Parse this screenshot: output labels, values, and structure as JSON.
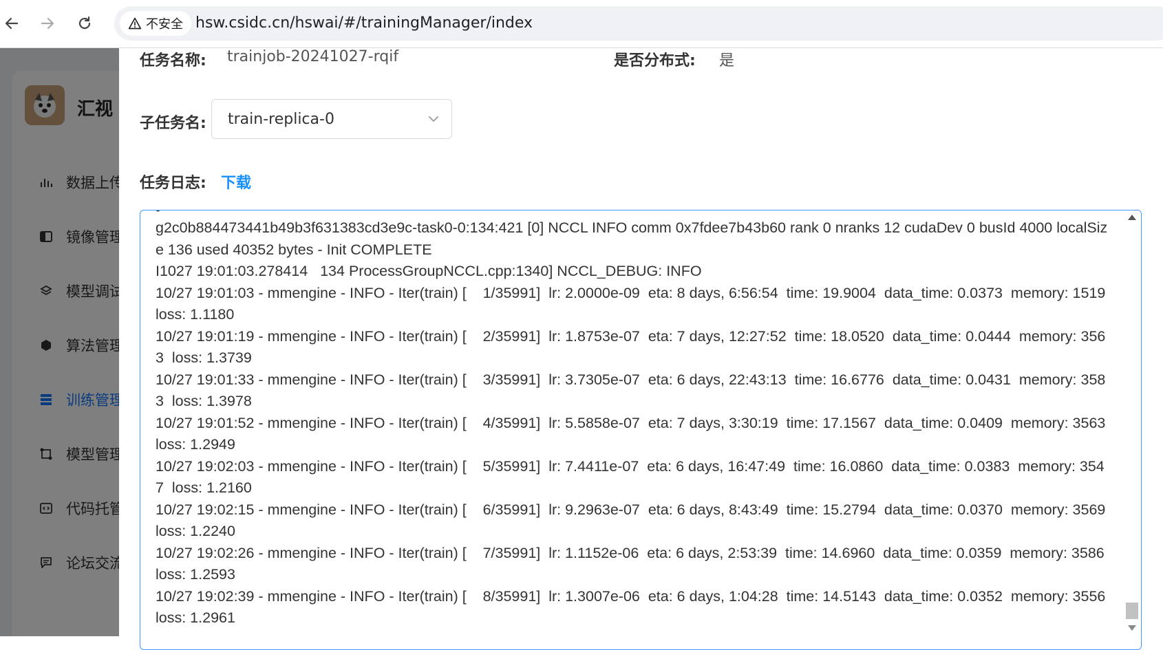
{
  "browser": {
    "back_icon": "arrow-left-icon",
    "forward_icon": "arrow-right-icon",
    "reload_icon": "reload-icon",
    "security_label": "不安全",
    "url": "hsw.csidc.cn/hswai/#/trainingManager/index"
  },
  "sidebar": {
    "brand": "汇视",
    "items": [
      {
        "label": "数据上传",
        "icon": "bar-chart-icon"
      },
      {
        "label": "镜像管理",
        "icon": "book-icon"
      },
      {
        "label": "模型调试",
        "icon": "layers-icon"
      },
      {
        "label": "算法管理",
        "icon": "cube-icon"
      },
      {
        "label": "训练管理",
        "icon": "list-icon",
        "active": true
      },
      {
        "label": "模型管理",
        "icon": "network-icon"
      },
      {
        "label": "代码托管",
        "icon": "code-icon"
      },
      {
        "label": "论坛交流",
        "icon": "chat-icon"
      }
    ]
  },
  "drawer": {
    "task_name_label": "任务名称:",
    "task_name_value": "trainjob-20241027-rqif",
    "distributed_label": "是否分布式:",
    "distributed_value": "是",
    "subtask_label": "子任务名:",
    "subtask_selected": "train-replica-0",
    "log_label": "任务日志:",
    "download_label": "下载",
    "log_text": "g2c0b884473441b49b3f631383cd3e9c-task0-0:134:421 [0] NCCL INFO comm 0x7fdee7b43b60 rank 0 nranks 12 cudaDev 0 busId 4000 localSize 136 used 40352 bytes - Init COMPLETE\nI1027 19:01:03.278414   134 ProcessGroupNCCL.cpp:1340] NCCL_DEBUG: INFO\n10/27 19:01:03 - mmengine - INFO - Iter(train) [    1/35991]  lr: 2.0000e-09  eta: 8 days, 6:56:54  time: 19.9004  data_time: 0.0373  memory: 1519  loss: 1.1180\n10/27 19:01:19 - mmengine - INFO - Iter(train) [    2/35991]  lr: 1.8753e-07  eta: 7 days, 12:27:52  time: 18.0520  data_time: 0.0444  memory: 3563  loss: 1.3739\n10/27 19:01:33 - mmengine - INFO - Iter(train) [    3/35991]  lr: 3.7305e-07  eta: 6 days, 22:43:13  time: 16.6776  data_time: 0.0431  memory: 3583  loss: 1.3978\n10/27 19:01:52 - mmengine - INFO - Iter(train) [    4/35991]  lr: 5.5858e-07  eta: 7 days, 3:30:19  time: 17.1567  data_time: 0.0409  memory: 3563  loss: 1.2949\n10/27 19:02:03 - mmengine - INFO - Iter(train) [    5/35991]  lr: 7.4411e-07  eta: 6 days, 16:47:49  time: 16.0860  data_time: 0.0383  memory: 3547  loss: 1.2160\n10/27 19:02:15 - mmengine - INFO - Iter(train) [    6/35991]  lr: 9.2963e-07  eta: 6 days, 8:43:49  time: 15.2794  data_time: 0.0370  memory: 3569  loss: 1.2240\n10/27 19:02:26 - mmengine - INFO - Iter(train) [    7/35991]  lr: 1.1152e-06  eta: 6 days, 2:53:39  time: 14.6960  data_time: 0.0359  memory: 3586  loss: 1.2593\n10/27 19:02:39 - mmengine - INFO - Iter(train) [    8/35991]  lr: 1.3007e-06  eta: 6 days, 1:04:28  time: 14.5143  data_time: 0.0352  memory: 3556  loss: 1.2961"
  },
  "colors": {
    "accent": "#1890ff",
    "active_menu": "#1677ff",
    "overlay": "rgba(0,0,0,0.5)"
  }
}
